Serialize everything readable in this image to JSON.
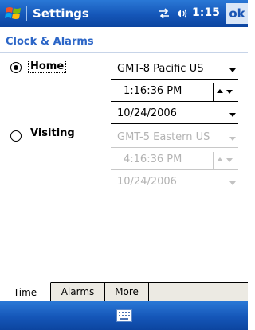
{
  "titlebar": {
    "title": "Settings",
    "time": "1:15",
    "ok_label": "ok",
    "start_icon": "windows-flag-icon",
    "connectivity_icon": "connectivity-icon",
    "volume_icon": "volume-icon"
  },
  "page": {
    "subtitle": "Clock & Alarms"
  },
  "home": {
    "label": "Home",
    "selected": true,
    "timezone": "GMT-8 Pacific US",
    "time": "1:16:36 PM",
    "date": "10/24/2006"
  },
  "visiting": {
    "label": "Visiting",
    "selected": false,
    "timezone": "GMT-5 Eastern US",
    "time": "4:16:36 PM",
    "date": "10/24/2006"
  },
  "tabs": [
    {
      "label": "Time",
      "active": true
    },
    {
      "label": "Alarms",
      "active": false
    },
    {
      "label": "More",
      "active": false
    }
  ],
  "bottombar": {
    "keyboard_icon": "keyboard-icon"
  },
  "colors": {
    "titlebar": "#1556b8",
    "subtitle": "#2c66c7",
    "disabled_text": "#b3b3b3"
  }
}
